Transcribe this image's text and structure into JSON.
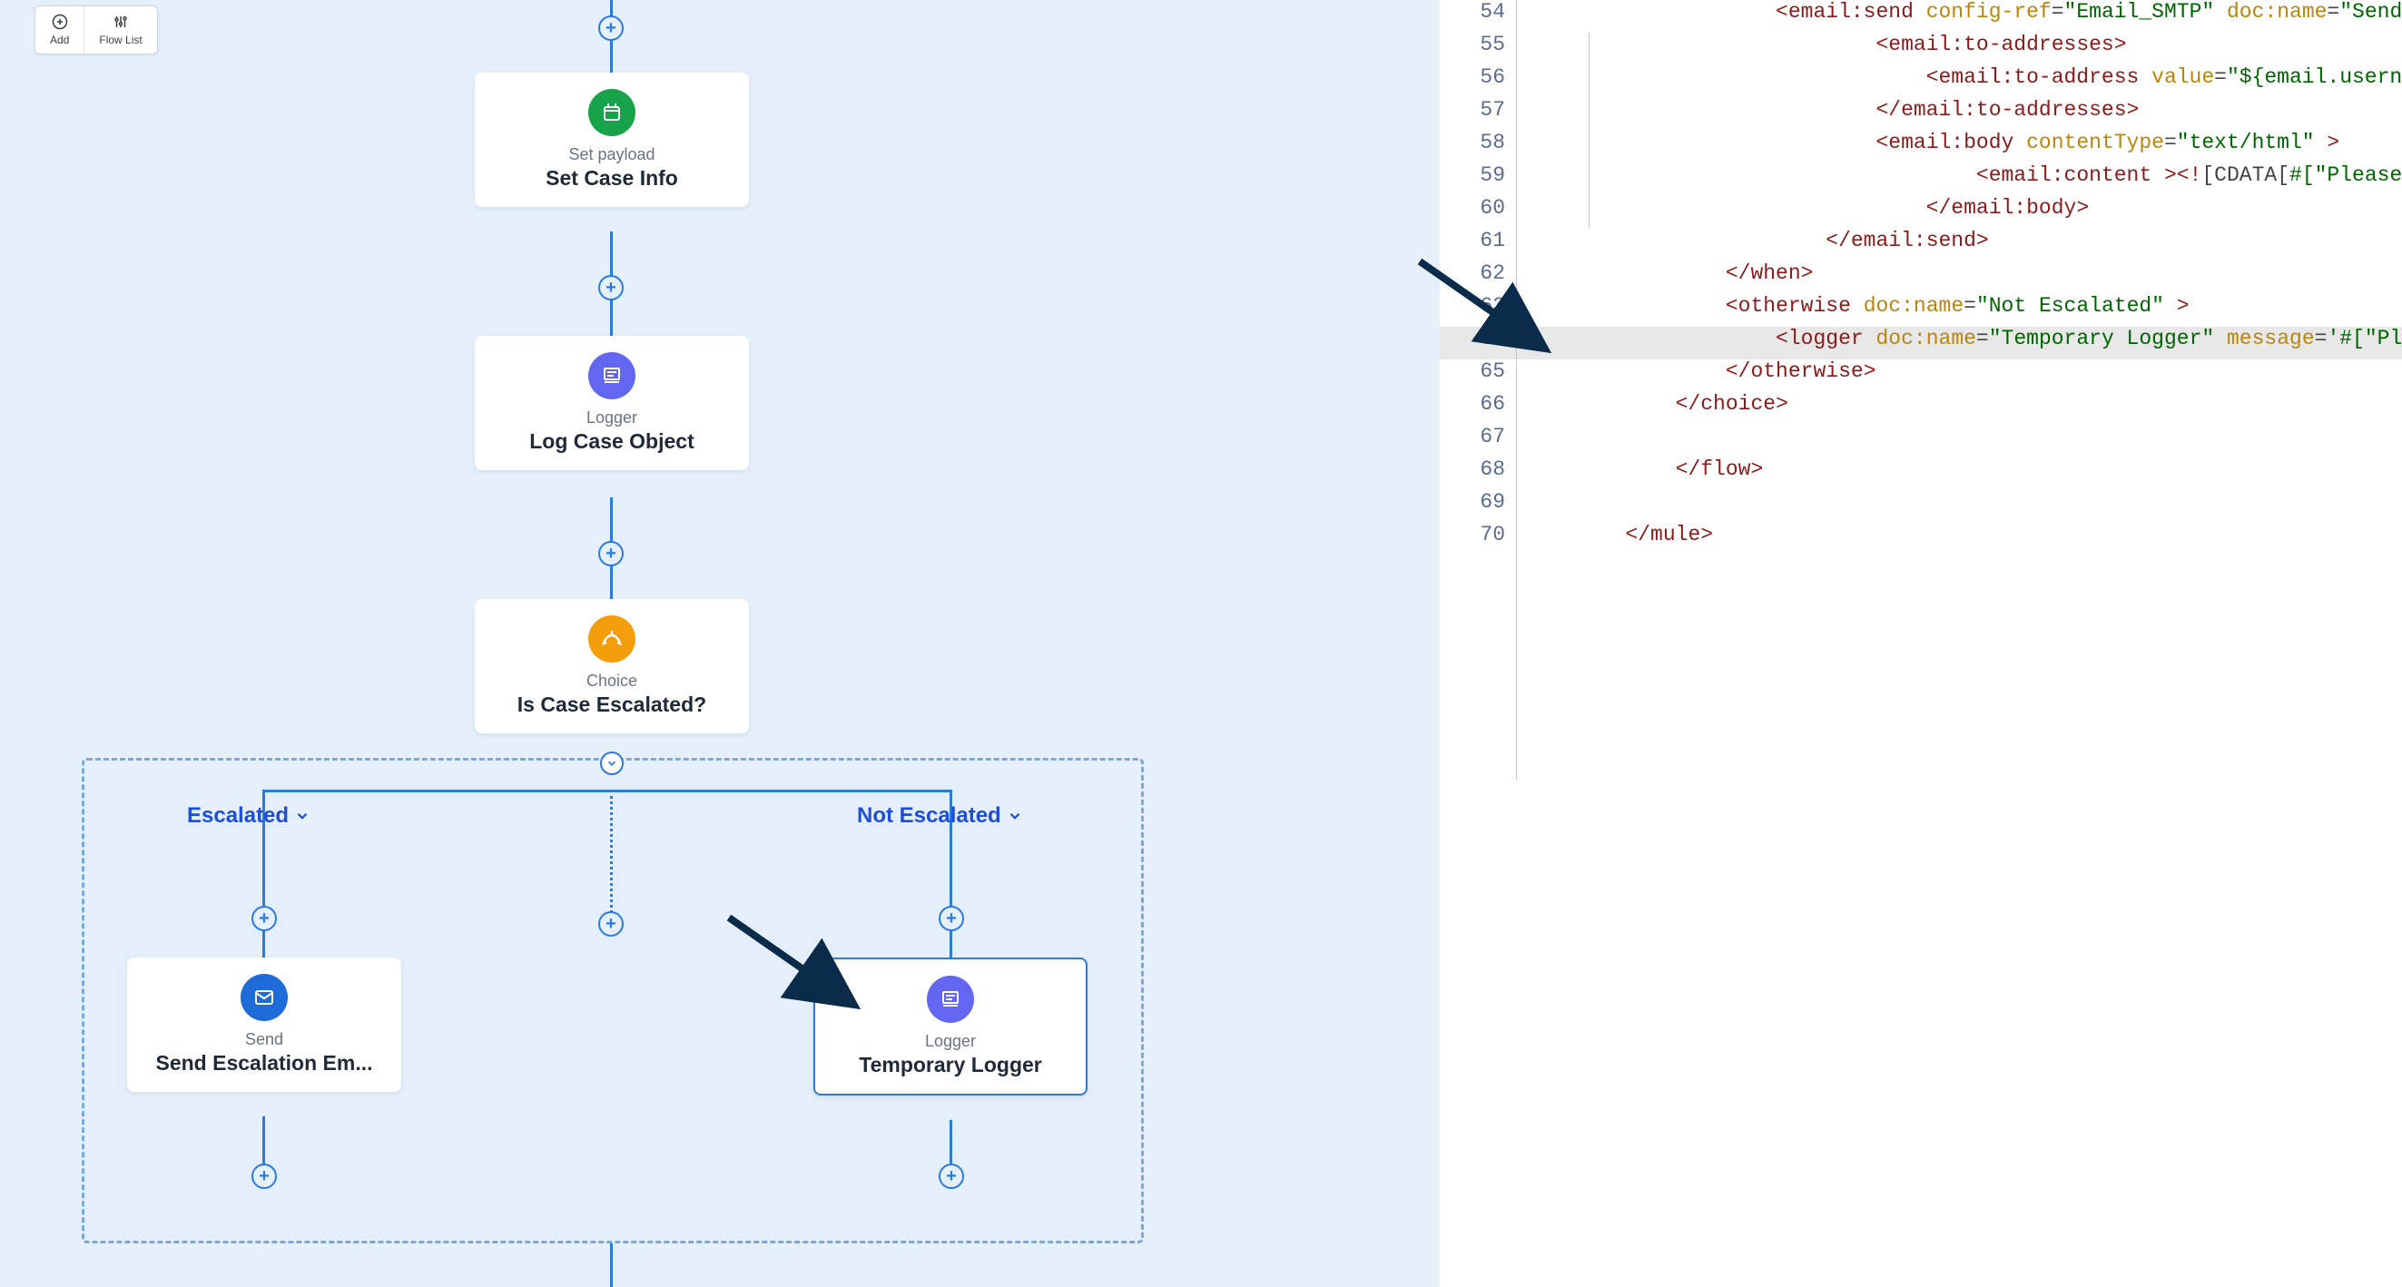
{
  "toolbar": {
    "add": "Add",
    "flowList": "Flow List"
  },
  "nodes": {
    "setPayload": {
      "type": "Set payload",
      "name": "Set Case Info"
    },
    "logger1": {
      "type": "Logger",
      "name": "Log Case Object"
    },
    "choice": {
      "type": "Choice",
      "name": "Is Case Escalated?"
    },
    "send": {
      "type": "Send",
      "name": "Send Escalation Em..."
    },
    "tempLogger": {
      "type": "Logger",
      "name": "Temporary Logger"
    }
  },
  "branches": {
    "escalated": "Escalated",
    "notEscalated": "Not Escalated"
  },
  "code": {
    "startLine": 54,
    "highlightLine": 64,
    "lines": [
      {
        "n": 54,
        "indent": 3,
        "type": "open",
        "tag": "email:send",
        "attrs": [
          {
            "k": "config-ref",
            "v": "Email_SMTP"
          },
          {
            "k": "doc:name",
            "v": "Send Escalat"
          }
        ],
        "trail": ""
      },
      {
        "n": 55,
        "indent": 5,
        "type": "open",
        "tag": "email:to-addresses",
        "close": true
      },
      {
        "n": 56,
        "indent": 6,
        "type": "self",
        "tag": "email:to-address",
        "attrs": [
          {
            "k": "value",
            "v": "${email.username}"
          }
        ]
      },
      {
        "n": 57,
        "indent": 5,
        "type": "closeTag",
        "tag": "email:to-addresses"
      },
      {
        "n": 58,
        "indent": 5,
        "type": "open",
        "tag": "email:body",
        "attrs": [
          {
            "k": "contentType",
            "v": "text/html"
          }
        ],
        "trail": " >"
      },
      {
        "n": 59,
        "indent": 7,
        "type": "cdata",
        "tag": "email:content",
        "cdata": "#[\"Please handle thi"
      },
      {
        "n": 60,
        "indent": 6,
        "type": "closeTag",
        "tag": "email:body"
      },
      {
        "n": 61,
        "indent": 4,
        "type": "closeTag",
        "tag": "email:send"
      },
      {
        "n": 62,
        "indent": 2,
        "type": "closeTag",
        "tag": "when"
      },
      {
        "n": 63,
        "indent": 2,
        "type": "open",
        "tag": "otherwise",
        "attrs": [
          {
            "k": "doc:name",
            "v": "Not Escalated"
          }
        ],
        "trail": " >"
      },
      {
        "n": 64,
        "indent": 3,
        "type": "open",
        "tag": "logger",
        "attrs": [
          {
            "k": "doc:name",
            "v": "Temporary Logger"
          },
          {
            "k": "message",
            "v": "#[\"Please look ",
            "q": "'"
          }
        ],
        "trail": ""
      },
      {
        "n": 65,
        "indent": 2,
        "type": "closeTag",
        "tag": "otherwise"
      },
      {
        "n": 66,
        "indent": 1,
        "type": "closeTag",
        "tag": "choice"
      },
      {
        "n": 67,
        "indent": 0,
        "type": "blank"
      },
      {
        "n": 68,
        "indent": 1,
        "type": "closeTag",
        "tag": "flow"
      },
      {
        "n": 69,
        "indent": 0,
        "type": "blank"
      },
      {
        "n": 70,
        "indent": 0,
        "type": "closeTag",
        "tag": "mule"
      }
    ]
  }
}
